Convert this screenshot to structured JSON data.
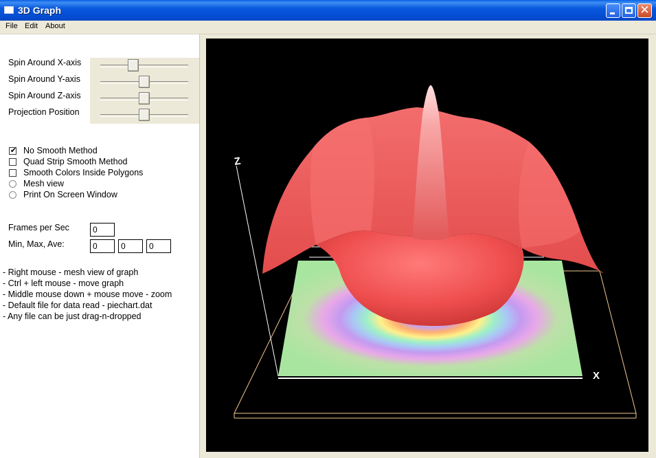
{
  "window": {
    "title": "3D Graph"
  },
  "menu": {
    "file": "File",
    "edit": "Edit",
    "about": "About"
  },
  "sliders": [
    {
      "label": "Spin Around X-axis",
      "value": 0.36
    },
    {
      "label": "Spin Around Y-axis",
      "value": 0.5
    },
    {
      "label": "Spin Around Z-axis",
      "value": 0.5
    },
    {
      "label": "Projection Position",
      "value": 0.5
    }
  ],
  "options": [
    {
      "label": "No Smooth Method",
      "kind": "checkbox",
      "checked": true
    },
    {
      "label": "Quad Strip Smooth Method",
      "kind": "checkbox",
      "checked": false
    },
    {
      "label": "Smooth Colors Inside Polygons",
      "kind": "checkbox",
      "checked": false
    },
    {
      "label": "Mesh view",
      "kind": "radio",
      "checked": false
    },
    {
      "label": "Print On Screen Window",
      "kind": "radio",
      "checked": false
    }
  ],
  "stats": {
    "fps_label": "Frames per Sec",
    "fps": "0",
    "mma_label": "Min, Max, Ave:",
    "min": "0",
    "max": "0",
    "ave": "0"
  },
  "help": [
    "- Right mouse - mesh view of graph",
    "- Ctrl + left mouse - move graph",
    "- Middle mouse down + mouse move - zoom",
    "- Default file for data read - piechart.dat",
    "- Any file can be just drag-n-dropped"
  ],
  "viewport": {
    "axis_z": "Z",
    "axis_x": "X",
    "background": "#000000",
    "surface_color": "#f05a5a",
    "peak_color": "#ffd6d6",
    "axis_color": "#f5c890"
  }
}
